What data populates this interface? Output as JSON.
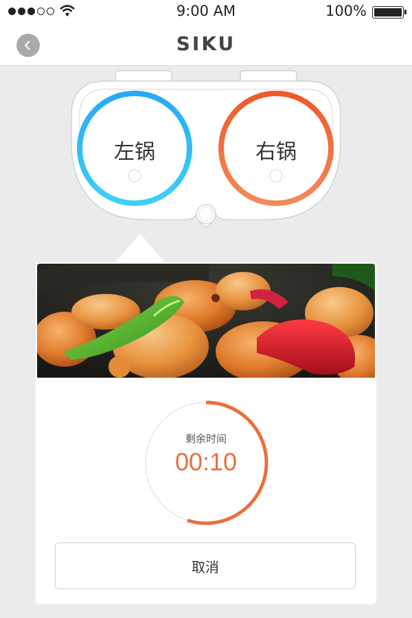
{
  "status_bar": {
    "time": "9:00 AM",
    "battery": "100%",
    "icons": [
      "signal-dots",
      "wifi-icon",
      "battery-icon"
    ]
  },
  "nav": {
    "title": "SIKU",
    "back_icon": "chevron-left-icon"
  },
  "device": {
    "left_pot": {
      "label": "左锅",
      "ring_colors": [
        "#27a9f5",
        "#3dd0f7"
      ]
    },
    "right_pot": {
      "label": "右锅",
      "ring_colors": [
        "#ee5a2c",
        "#f4895a"
      ]
    }
  },
  "cooking": {
    "image_alt": "food-photo",
    "remaining_label": "剩余时间",
    "remaining_time": "00:10",
    "progress": 0.55,
    "accent": "#ea6f3d",
    "cancel_label": "取消"
  }
}
